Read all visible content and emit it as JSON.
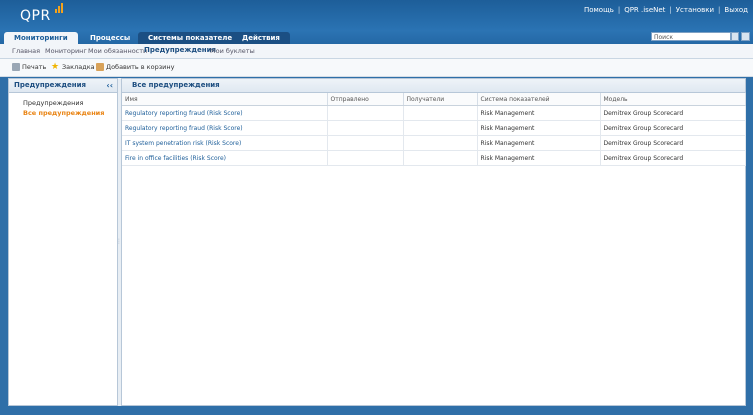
{
  "app": {
    "logo": "QPR",
    "top_links": [
      "Помощь",
      "QPR .iseNet",
      "Установки",
      "Выход"
    ],
    "accent": "#2a73b3",
    "highlight": "#e98312"
  },
  "tabs": [
    {
      "label": "Мониторинги"
    },
    {
      "label": "Процессы"
    },
    {
      "label": "Системы показателей"
    },
    {
      "label": "Действия"
    }
  ],
  "search": {
    "placeholder": "Поиск"
  },
  "subnav": [
    "Главная",
    "Мониторинг",
    "Мои обязанности",
    "Предупреждения",
    "Мои буклеты"
  ],
  "toolbar": {
    "print": "Печать",
    "bookmark": "Закладка",
    "add_basket": "Добавить в корзину"
  },
  "left_panel": {
    "title": "Предупреждения",
    "items": [
      "Предупреждения",
      "Все предупреждения"
    ]
  },
  "main_panel": {
    "title": "Все предупреждения",
    "columns": [
      "Имя",
      "Отправлено",
      "Получатели",
      "Система показателей",
      "Модель"
    ],
    "rows": [
      {
        "name": "Regulatory reporting fraud (Risk Score)",
        "sent": "",
        "recipients": "",
        "scorecard": "Risk Management",
        "model": "Demitrex Group Scorecard"
      },
      {
        "name": "Regulatory reporting fraud (Risk Score)",
        "sent": "",
        "recipients": "",
        "scorecard": "Risk Management",
        "model": "Demitrex Group Scorecard"
      },
      {
        "name": "IT system penetration risk (Risk Score)",
        "sent": "",
        "recipients": "",
        "scorecard": "Risk Management",
        "model": "Demitrex Group Scorecard"
      },
      {
        "name": "Fire in office facilities (Risk Score)",
        "sent": "",
        "recipients": "",
        "scorecard": "Risk Management",
        "model": "Demitrex Group Scorecard"
      }
    ]
  }
}
